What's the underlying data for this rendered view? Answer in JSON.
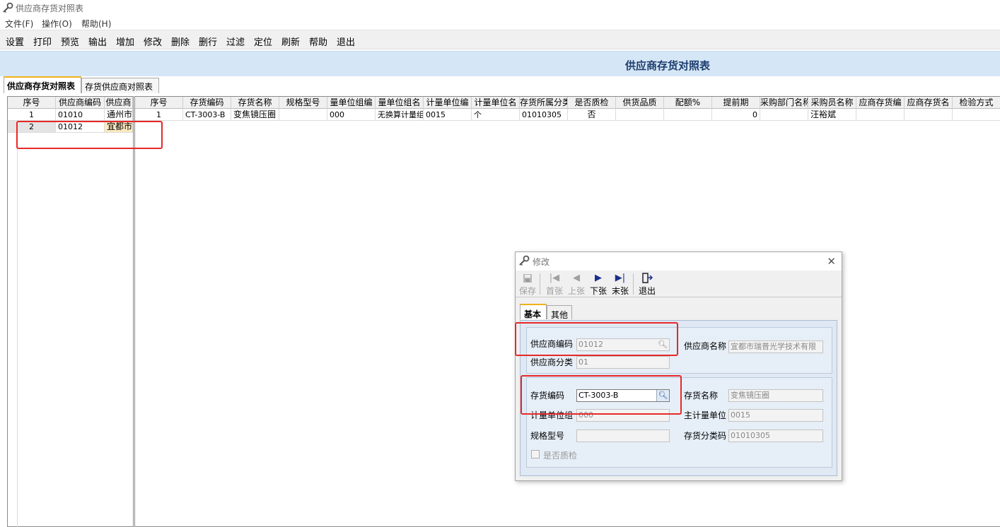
{
  "window": {
    "title": "供应商存货对照表"
  },
  "menu": [
    "文件(F)",
    "操作(O)",
    "帮助(H)"
  ],
  "toolbar": [
    "设置",
    "打印",
    "预览",
    "输出",
    "增加",
    "修改",
    "删除",
    "删行",
    "过滤",
    "定位",
    "刷新",
    "帮助",
    "退出"
  ],
  "banner": {
    "title": "供应商存货对照表"
  },
  "tabs": [
    "供应商存货对照表",
    "存货供应商对照表"
  ],
  "left_grid": {
    "headers": [
      "序号",
      "供应商编码",
      "供应商"
    ],
    "rows": [
      [
        "1",
        "01010",
        "通州市"
      ],
      [
        "2",
        "01012",
        "宜都市"
      ]
    ]
  },
  "right_grid": {
    "headers": [
      "序号",
      "存货编码",
      "存货名称",
      "规格型号",
      "量单位组编",
      "量单位组名",
      "计量单位编",
      "计量单位名",
      "存货所属分类",
      "是否质检",
      "供货品质",
      "配额%",
      "提前期",
      "采购部门名称",
      "采购员名称",
      "应商存货编",
      "应商存货名",
      "检验方式"
    ],
    "rows": [
      [
        "1",
        "CT-3003-B",
        "变焦镜压圈",
        "",
        "000",
        "无换算计量组",
        "0015",
        "个",
        "01010305",
        "否",
        "",
        "",
        "0",
        "",
        "汪裕斌",
        "",
        "",
        ""
      ]
    ]
  },
  "dialog": {
    "title": "修改",
    "toolbar": {
      "save": "保存",
      "first": "首张",
      "prev": "上张",
      "next": "下张",
      "last": "末张",
      "exit": "退出"
    },
    "tabs": [
      "基本",
      "其他"
    ],
    "fields": {
      "supplier_code_label": "供应商编码",
      "supplier_code": "01012",
      "supplier_name_label": "供应商名称",
      "supplier_name": "宜都市瑞普光学技术有限",
      "supplier_class_label": "供应商分类",
      "supplier_class": "01",
      "inventory_code_label": "存货编码",
      "inventory_code": "CT-3003-B",
      "inventory_name_label": "存货名称",
      "inventory_name": "变焦镜压圈",
      "unit_group_label": "计量单位组",
      "unit_group": "000",
      "main_unit_label": "主计量单位",
      "main_unit": "0015",
      "spec_label": "规格型号",
      "spec": "",
      "inventory_class_label": "存货分类码",
      "inventory_class": "01010305",
      "quality_check_label": "是否质检"
    }
  },
  "colors": {
    "highlight": "#e82828",
    "banner": "#d5e6f6",
    "tab_accent": "#f0b21a"
  }
}
